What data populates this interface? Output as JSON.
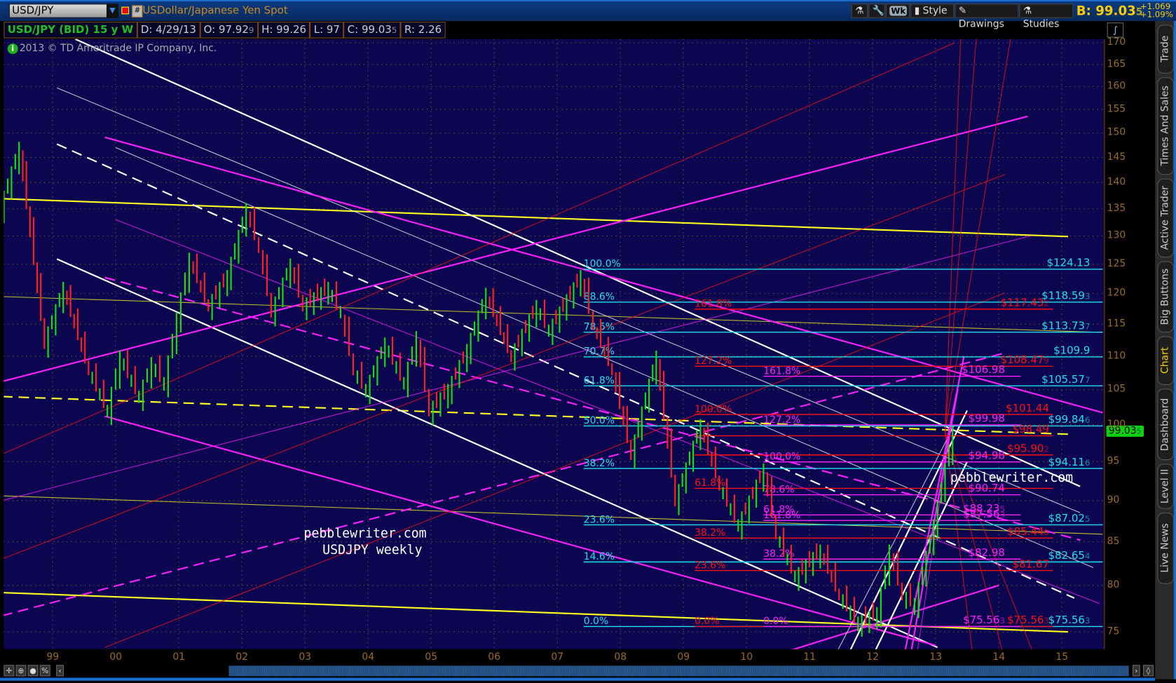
{
  "toolbar": {
    "symbol": "USD/JPY",
    "title": "USDollar/Japanese Yen Spot",
    "hash": "#",
    "aggregation": "Wk",
    "style": "Style",
    "drawings": "Drawings",
    "studies": "Studies",
    "bid_label": "B: 99.03",
    "bid_suffix": "5",
    "change": "+1.069",
    "change_pct": "+1.09%"
  },
  "info": {
    "name": "USD/JPY (BID) 15 y W",
    "date": "D: 4/29/13",
    "open": "O: 97.92",
    "open_suffix": "9",
    "high": "H: 99.26",
    "low": "L: 97",
    "close": "C: 99.03",
    "close_suffix": "5",
    "range": "R: 2.26"
  },
  "copyright": "2013 © TD Ameritrade IP Company, Inc.",
  "last_price": {
    "value": "99.03",
    "suffix": "5"
  },
  "sidebar": [
    "Trade",
    "Times And Sales",
    "Active Trader",
    "Big Buttons",
    "Chart",
    "Dashboard",
    "Level II",
    "Live News"
  ],
  "colors": {
    "bg": "#0c0650",
    "cyan": "#20e0f0",
    "red": "#ff1010",
    "magenta": "#ff20ff",
    "yellow": "#ffff20",
    "white": "#ffffff",
    "up": "#10e010",
    "down": "#ff2020"
  },
  "chart_data": {
    "type": "line",
    "title": "USDJPY weekly",
    "scale": "log",
    "ylim": [
      72,
      172
    ],
    "xlim": [
      1998.2,
      2015.65
    ],
    "y_ticks": [
      170,
      165,
      160,
      155,
      150,
      145,
      140,
      135,
      130,
      125,
      120,
      115,
      110,
      105,
      100,
      95,
      90,
      85,
      80,
      75
    ],
    "x_ticks": [
      {
        "v": 1999,
        "l": "99"
      },
      {
        "v": 2000,
        "l": "00"
      },
      {
        "v": 2001,
        "l": "01"
      },
      {
        "v": 2002,
        "l": "02"
      },
      {
        "v": 2003,
        "l": "03"
      },
      {
        "v": 2004,
        "l": "04"
      },
      {
        "v": 2005,
        "l": "05"
      },
      {
        "v": 2006,
        "l": "06"
      },
      {
        "v": 2007,
        "l": "07"
      },
      {
        "v": 2008,
        "l": "08"
      },
      {
        "v": 2009,
        "l": "09"
      },
      {
        "v": 2010,
        "l": "10"
      },
      {
        "v": 2011,
        "l": "11"
      },
      {
        "v": 2012,
        "l": "12"
      },
      {
        "v": 2013,
        "l": "13"
      },
      {
        "v": 2014,
        "l": "14"
      },
      {
        "v": 2015,
        "l": "15"
      }
    ],
    "price": [
      [
        1998.2,
        135
      ],
      [
        1998.5,
        147
      ],
      [
        1998.9,
        112
      ],
      [
        1999.2,
        121
      ],
      [
        1999.6,
        108
      ],
      [
        1999.9,
        102
      ],
      [
        2000.1,
        110
      ],
      [
        2000.4,
        104
      ],
      [
        2000.6,
        109
      ],
      [
        2000.8,
        106
      ],
      [
        2001.0,
        116
      ],
      [
        2001.2,
        126
      ],
      [
        2001.5,
        118
      ],
      [
        2001.8,
        123
      ],
      [
        2002.1,
        135
      ],
      [
        2002.3,
        128
      ],
      [
        2002.5,
        117
      ],
      [
        2002.8,
        125
      ],
      [
        2003.0,
        118
      ],
      [
        2003.4,
        121
      ],
      [
        2003.6,
        117
      ],
      [
        2003.8,
        108
      ],
      [
        2004.0,
        105
      ],
      [
        2004.3,
        112
      ],
      [
        2004.6,
        106
      ],
      [
        2004.8,
        113
      ],
      [
        2005.0,
        102
      ],
      [
        2005.3,
        105
      ],
      [
        2005.6,
        111
      ],
      [
        2005.9,
        120
      ],
      [
        2006.3,
        110
      ],
      [
        2006.7,
        118
      ],
      [
        2006.9,
        114
      ],
      [
        2007.4,
        123
      ],
      [
        2007.6,
        115
      ],
      [
        2007.9,
        108
      ],
      [
        2008.2,
        96
      ],
      [
        2008.6,
        110
      ],
      [
        2008.9,
        90
      ],
      [
        2009.3,
        100
      ],
      [
        2009.6,
        92
      ],
      [
        2009.9,
        87
      ],
      [
        2010.3,
        94
      ],
      [
        2010.5,
        86
      ],
      [
        2010.8,
        81
      ],
      [
        2011.2,
        84
      ],
      [
        2011.5,
        79
      ],
      [
        2011.8,
        76
      ],
      [
        2012.1,
        77
      ],
      [
        2012.3,
        84
      ],
      [
        2012.5,
        79
      ],
      [
        2012.7,
        78
      ],
      [
        2013.0,
        87
      ],
      [
        2013.3,
        99.03
      ]
    ],
    "fib_cyan": [
      {
        "pct": "100.0%",
        "level": 124.13,
        "label": "$124.13",
        "sfx": ""
      },
      {
        "pct": "88.6%",
        "level": 118.59,
        "label": "$118.59",
        "sfx": "3"
      },
      {
        "pct": "78.6%",
        "level": 113.73,
        "label": "$113.73",
        "sfx": "7"
      },
      {
        "pct": "70.7%",
        "level": 109.9,
        "label": "$109.9",
        "sfx": ""
      },
      {
        "pct": "61.8%",
        "level": 105.57,
        "label": "$105.57",
        "sfx": "7"
      },
      {
        "pct": "50.0%",
        "level": 99.84,
        "label": "$99.84",
        "sfx": "6"
      },
      {
        "pct": "38.2%",
        "level": 94.11,
        "label": "$94.11",
        "sfx": "6"
      },
      {
        "pct": "23.6%",
        "level": 87.02,
        "label": "$87.02",
        "sfx": "5"
      },
      {
        "pct": "14.6%",
        "level": 82.65,
        "label": "$82.65",
        "sfx": "4"
      },
      {
        "pct": "0.0%",
        "level": 75.56,
        "label": "$75.56",
        "sfx": "3"
      }
    ],
    "fib_red": [
      {
        "pct": "161.8%",
        "level": 117.43,
        "label": "$117.43",
        "sfx": "2"
      },
      {
        "pct": "127.2%",
        "level": 108.47,
        "label": "$108.47",
        "sfx": "9"
      },
      {
        "pct": "100.0%",
        "level": 101.44,
        "label": "$101.44",
        "sfx": ""
      },
      {
        "pct": "",
        "level": 98.49,
        "label": "$98.49",
        "sfx": ""
      },
      {
        "pct": "",
        "level": 95.9,
        "label": "$95.90",
        "sfx": "2"
      },
      {
        "pct": "61.8%",
        "level": 91.55,
        "label": "",
        "sfx": ""
      },
      {
        "pct": "38.2%",
        "level": 85.44,
        "label": "$85.44",
        "sfx": "8"
      },
      {
        "pct": "23.6%",
        "level": 81.67,
        "label": "$81.67",
        "sfx": ""
      },
      {
        "pct": "0.0%",
        "level": 75.56,
        "label": "$75.56",
        "sfx": "3"
      }
    ],
    "fib_magenta": [
      {
        "pct": "161.8%",
        "level": 106.98,
        "label": "$106.98",
        "sfx": ""
      },
      {
        "pct": "127.2%",
        "level": 99.98,
        "label": "$99.98",
        "sfx": ""
      },
      {
        "pct": "100.0%",
        "level": 94.98,
        "label": "$94.98",
        "sfx": ""
      },
      {
        "pct": "78.6%",
        "level": 90.74,
        "label": "$90.74",
        "sfx": ""
      },
      {
        "pct": "61.8%",
        "level": 88.23,
        "label": "$88.23",
        "sfx": "5"
      },
      {
        "pct": "161.8%",
        "level": 87.56,
        "label": "$87.56",
        "sfx": "3"
      },
      {
        "pct": "38.2%",
        "level": 82.98,
        "label": "$82.98",
        "sfx": ""
      },
      {
        "pct": "0.0%",
        "level": 75.56,
        "label": "$75.56",
        "sfx": "3"
      }
    ],
    "trendlines": [
      {
        "c": "yellow",
        "w": 2,
        "p": [
          [
            1998.2,
            136.9
          ],
          [
            2015.1,
            129.9
          ]
        ]
      },
      {
        "c": "yellow",
        "w": 2,
        "d": true,
        "p": [
          [
            1998.2,
            104.0
          ],
          [
            2015.1,
            98.7
          ]
        ]
      },
      {
        "c": "yellow",
        "w": 1,
        "p": [
          [
            1998.2,
            119.5
          ],
          [
            2015.65,
            113.7
          ]
        ]
      },
      {
        "c": "yellow",
        "w": 1,
        "p": [
          [
            1998.2,
            90.6
          ],
          [
            2015.65,
            85.9
          ]
        ]
      },
      {
        "c": "yellow",
        "w": 2,
        "p": [
          [
            1998.2,
            79.2
          ],
          [
            2015.1,
            75.0
          ]
        ]
      },
      {
        "c": "white",
        "w": 2,
        "p": [
          [
            1999.36,
            170.9
          ],
          [
            2015.29,
            91.8
          ]
        ]
      },
      {
        "c": "white",
        "w": 2,
        "d": true,
        "p": [
          [
            1999.07,
            147.7
          ],
          [
            2015.2,
            78.6
          ]
        ]
      },
      {
        "c": "white",
        "w": 2,
        "p": [
          [
            1999.07,
            125.9
          ],
          [
            2013.03,
            73.4
          ]
        ]
      },
      {
        "c": "white",
        "w": 1,
        "p": [
          [
            1999.07,
            159.7
          ],
          [
            2015.29,
            88.5
          ]
        ]
      },
      {
        "c": "white",
        "w": 1,
        "p": [
          [
            2000.0,
            147.0
          ],
          [
            2015.5,
            82.0
          ]
        ]
      },
      {
        "c": "magenta",
        "w": 2,
        "p": [
          [
            1999.83,
            149.1
          ],
          [
            2015.65,
            101.7
          ]
        ]
      },
      {
        "c": "magenta",
        "w": 2,
        "p": [
          [
            1998.2,
            106.2
          ],
          [
            2014.46,
            153.5
          ]
        ]
      },
      {
        "c": "magenta",
        "w": 2,
        "d": true,
        "p": [
          [
            1999.83,
            122.7
          ],
          [
            2015.29,
            85.2
          ]
        ]
      },
      {
        "c": "magenta",
        "w": 2,
        "p": [
          [
            1999.83,
            101.2
          ],
          [
            2013.0,
            73.6
          ]
        ]
      },
      {
        "c": "magenta",
        "w": 2,
        "d": true,
        "p": [
          [
            1998.2,
            76.7
          ],
          [
            2014.1,
            110.5
          ]
        ]
      },
      {
        "c": "magenta",
        "w": 1,
        "p": [
          [
            1998.2,
            90.0
          ],
          [
            2014.5,
            130.0
          ]
        ]
      },
      {
        "c": "magenta",
        "w": 1,
        "p": [
          [
            2000.0,
            133.0
          ],
          [
            2015.6,
            78.0
          ]
        ]
      },
      {
        "c": "magenta",
        "w": 2,
        "p": [
          [
            2010.4,
            72.5
          ],
          [
            2014.0,
            80.0
          ]
        ]
      },
      {
        "c": "red",
        "w": 1,
        "p": [
          [
            1998.2,
            83.0
          ],
          [
            2014.1,
            141.6
          ]
        ]
      },
      {
        "c": "red",
        "w": 1,
        "p": [
          [
            1999.83,
            73.4
          ],
          [
            2014.1,
            120.1
          ]
        ]
      },
      {
        "c": "red",
        "w": 1,
        "p": [
          [
            1998.2,
            96.0
          ],
          [
            2013.3,
            170.0
          ]
        ]
      },
      {
        "c": "red",
        "w": 1,
        "p": [
          [
            2013.15,
            99.0
          ],
          [
            2013.4,
            172.0
          ]
        ]
      },
      {
        "c": "red",
        "w": 1,
        "p": [
          [
            2013.15,
            99.0
          ],
          [
            2013.65,
            172.0
          ]
        ]
      },
      {
        "c": "red",
        "w": 1,
        "p": [
          [
            2013.15,
            99.0
          ],
          [
            2014.2,
            172.0
          ]
        ]
      },
      {
        "c": "red",
        "w": 1,
        "p": [
          [
            2013.15,
            99.0
          ],
          [
            2013.6,
            72.0
          ]
        ]
      },
      {
        "c": "red",
        "w": 1,
        "p": [
          [
            2013.15,
            99.0
          ],
          [
            2014.1,
            72.0
          ]
        ]
      },
      {
        "c": "red",
        "w": 1,
        "p": [
          [
            2013.15,
            99.0
          ],
          [
            2014.6,
            72.0
          ]
        ]
      },
      {
        "c": "white",
        "w": 2,
        "p": [
          [
            2011.6,
            72.5
          ],
          [
            2013.5,
            102.0
          ]
        ]
      },
      {
        "c": "white",
        "w": 2,
        "p": [
          [
            2012.0,
            72.5
          ],
          [
            2013.5,
            95.0
          ]
        ]
      },
      {
        "c": "white",
        "w": 1,
        "p": [
          [
            2011.4,
            72.5
          ],
          [
            2013.3,
            100.0
          ]
        ]
      },
      {
        "c": "magenta",
        "w": 2,
        "p": [
          [
            2012.5,
            72.5
          ],
          [
            2013.45,
            110.0
          ]
        ]
      },
      {
        "c": "magenta",
        "w": 2,
        "p": [
          [
            2012.6,
            72.5
          ],
          [
            2013.35,
            105.0
          ]
        ]
      },
      {
        "c": "magenta",
        "w": 1,
        "p": [
          [
            2012.7,
            72.5
          ],
          [
            2013.25,
            100.0
          ]
        ]
      }
    ],
    "annotations": [
      "pebblewriter.com",
      "USDJPY weekly",
      "pebblewriter.com"
    ]
  }
}
